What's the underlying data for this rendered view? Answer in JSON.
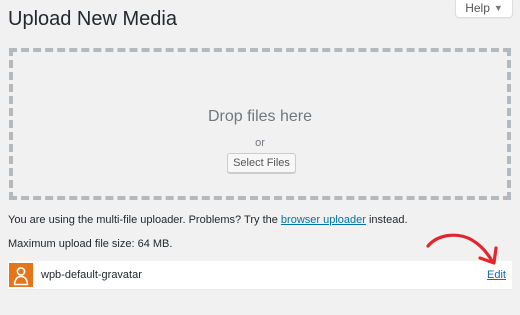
{
  "header": {
    "title": "Upload New Media",
    "help_label": "Help",
    "help_caret": "▼"
  },
  "uploader": {
    "drop_text": "Drop files here",
    "or_text": "or",
    "select_button": "Select Files",
    "help_prefix": "You are using the multi-file uploader. Problems? Try the ",
    "help_link": "browser uploader",
    "help_suffix": " instead.",
    "max_size": "Maximum upload file size: 64 MB."
  },
  "files": [
    {
      "name": "wpb-default-gravatar",
      "edit_label": "Edit",
      "icon": "default-avatar-icon"
    }
  ],
  "colors": {
    "background": "#f1f1f1",
    "link": "#0073aa",
    "thumb": "#e4751b",
    "annotation_arrow": "#e3262e"
  }
}
